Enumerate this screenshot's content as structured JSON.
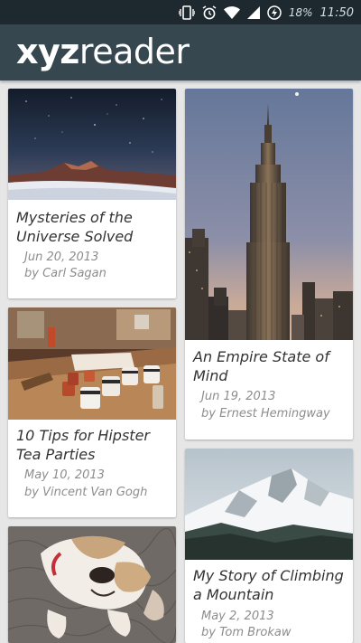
{
  "status_bar": {
    "battery": "18%",
    "time": "11:50",
    "icons": [
      "vibrate-icon",
      "alarm-icon",
      "wifi-icon",
      "cell-signal-icon",
      "battery-icon"
    ]
  },
  "app": {
    "logo_bold": "xyz",
    "logo_light": "reader",
    "bar_color": "#36474f",
    "status_color": "#1e292f"
  },
  "articles": [
    {
      "title": "Mysteries of the Universe Solved",
      "date": "Jun 20, 2013",
      "author": "by Carl Sagan",
      "image": "starry-night-mountain"
    },
    {
      "title": "An Empire State of Mind",
      "date": "Jun 19, 2013",
      "author": "by Ernest Hemingway",
      "image": "empire-state-building"
    },
    {
      "title": "10 Tips for Hipster Tea Parties",
      "date": "May 10, 2013",
      "author": "by Vincent Van Gogh",
      "image": "tea-cups-table"
    },
    {
      "title": "My Story of Climbing a Mountain",
      "date": "May 2, 2013",
      "author": "by Tom Brokaw",
      "image": "snowy-mountain"
    },
    {
      "title": "",
      "date": "",
      "author": "",
      "image": "bulldog"
    }
  ]
}
